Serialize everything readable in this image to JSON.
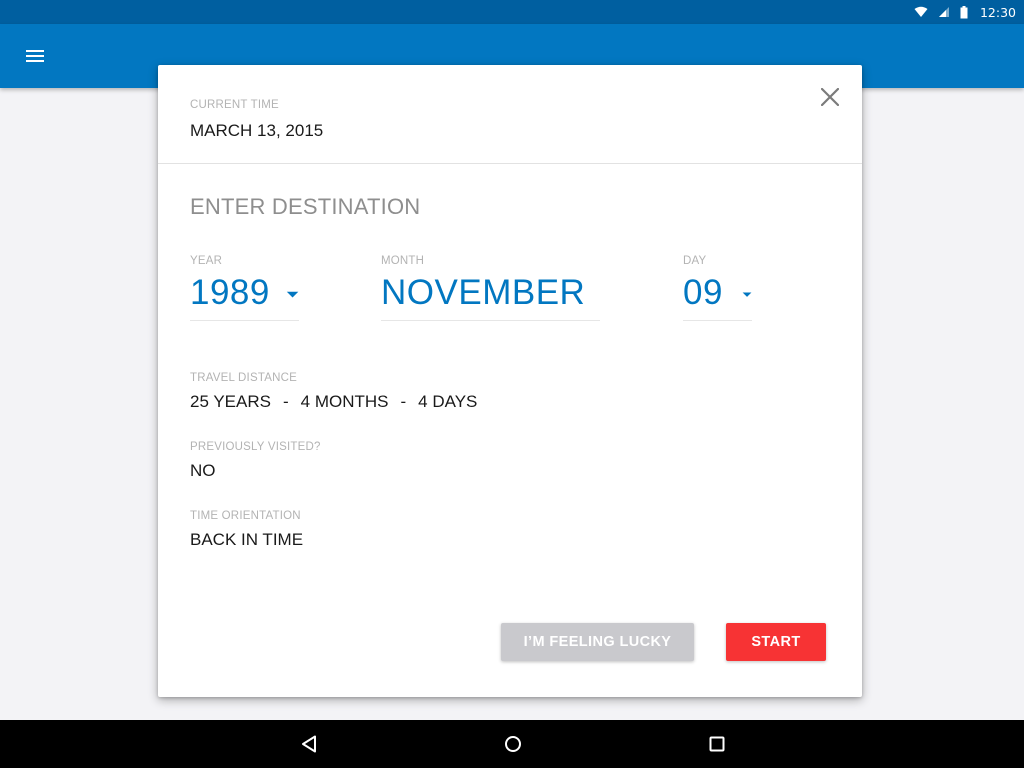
{
  "status_bar": {
    "time": "12:30",
    "icons": [
      "wifi-icon",
      "signal-icon",
      "battery-icon"
    ]
  },
  "app_bar": {
    "menu_icon": "menu-icon",
    "color": "#0277c1"
  },
  "dialog": {
    "current_time_label": "CURRENT TIME",
    "current_time_value": "MARCH 13, 2015",
    "close_icon": "close-icon",
    "section_title": "ENTER DESTINATION",
    "pickers": {
      "year": {
        "label": "YEAR",
        "value": "1989"
      },
      "month": {
        "label": "MONTH",
        "value": "NOVEMBER"
      },
      "day": {
        "label": "DAY",
        "value": "09"
      }
    },
    "travel_distance": {
      "label": "TRAVEL DISTANCE",
      "years": "25 YEARS",
      "separator": "-",
      "months": "4 MONTHS",
      "days": "4 DAYS"
    },
    "previously_visited": {
      "label": "PREVIOUSLY VISITED?",
      "value": "NO"
    },
    "time_orientation": {
      "label": "TIME ORIENTATION",
      "value": "BACK IN TIME"
    },
    "buttons": {
      "lucky": "I’M FEELING LUCKY",
      "start": "START"
    }
  },
  "colors": {
    "accent": "#0277c1",
    "start": "#f73334",
    "lucky": "#c9c9cd"
  },
  "nav_bar": {
    "icons": [
      "back-icon",
      "home-icon",
      "recents-icon"
    ]
  }
}
